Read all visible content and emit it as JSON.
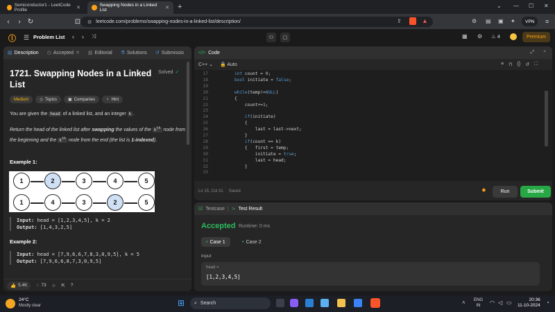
{
  "browser": {
    "tabs": [
      {
        "title": "Semiconductor1 - LeetCode Profile"
      },
      {
        "title": "Swapping Nodes in a Linked List"
      }
    ],
    "url": "leetcode.com/problems/swapping-nodes-in-a-linked-list/description/",
    "vpn_label": "VPN"
  },
  "header": {
    "problem_list_label": "Problem List",
    "streak_count": "4",
    "premium_label": "Premium"
  },
  "left_tabs": [
    {
      "label": "Description"
    },
    {
      "label": "Accepted"
    },
    {
      "label": "Editorial"
    },
    {
      "label": "Solutions"
    },
    {
      "label": "Submissio"
    }
  ],
  "problem": {
    "title": "1721. Swapping Nodes in a Linked List",
    "solved_label": "Solved",
    "difficulty": "Medium",
    "tags": [
      "Topics",
      "Companies",
      "Hint"
    ],
    "desc1_pre": "You are given the",
    "desc1_code": "head",
    "desc1_mid": "of a linked list, and an integer",
    "desc1_code2": "k",
    "desc1_post": ".",
    "desc2_a": "Return the head of the linked list after",
    "desc2_b": "swapping",
    "desc2_c": "the values of the",
    "desc2_d": "k",
    "desc2_e": "th",
    "desc2_f": "node",
    "desc2_g": "from the beginning and the",
    "desc2_h": "node from the end (the list is",
    "desc2_i": "1-indexed",
    "desc2_j": ").",
    "example1_title": "Example 1:",
    "list_top": [
      "1",
      "2",
      "3",
      "4",
      "5"
    ],
    "list_bottom": [
      "1",
      "4",
      "3",
      "2",
      "5"
    ],
    "ex1_input_label": "Input:",
    "ex1_input": "head = [1,2,3,4,5], k = 2",
    "ex1_output_label": "Output:",
    "ex1_output": "[1,4,3,2,5]",
    "example2_title": "Example 2:",
    "ex2_input_label": "Input:",
    "ex2_input": "head = [7,9,6,6,7,8,3,0,9,5], k = 5",
    "ex2_output_label": "Output:",
    "ex2_output": "[7,9,6,6,8,7,3,0,9,5]",
    "likes": "5.4K",
    "comments": "73"
  },
  "code_panel": {
    "title": "Code",
    "language": "C++",
    "mode": "Auto",
    "status": "Ln 15, Col 31",
    "saved": "Saved",
    "run_label": "Run",
    "submit_label": "Submit"
  },
  "code_lines": [
    {
      "n": "17",
      "text": "int count = 0;"
    },
    {
      "n": "18",
      "text": "bool initiate = false;"
    },
    {
      "n": "19",
      "text": ""
    },
    {
      "n": "20",
      "text": "while(temp!=NULL)"
    },
    {
      "n": "21",
      "text": "{"
    },
    {
      "n": "22",
      "text": "    count+=1;"
    },
    {
      "n": "23",
      "text": ""
    },
    {
      "n": "24",
      "text": "    if(initiate)"
    },
    {
      "n": "25",
      "text": "    {"
    },
    {
      "n": "26",
      "text": "        last = last->next;"
    },
    {
      "n": "27",
      "text": "    }"
    },
    {
      "n": "28",
      "text": "    if(count == k)"
    },
    {
      "n": "29",
      "text": "    {   first = temp;"
    },
    {
      "n": "30",
      "text": "        initiate = true;"
    },
    {
      "n": "31",
      "text": "        last = head;"
    },
    {
      "n": "32",
      "text": "    }"
    },
    {
      "n": "33",
      "text": ""
    }
  ],
  "result_panel": {
    "testcase_label": "Testcase",
    "result_label": "Test Result",
    "accepted_label": "Accepted",
    "runtime": "Runtime: 0 ms",
    "case1": "Case 1",
    "case2": "Case 2",
    "input_label": "Input",
    "var_label": "head =",
    "var_value": "[1,2,3,4,5]"
  },
  "taskbar": {
    "temp": "24°C",
    "weather": "Mostly clear",
    "search": "Search",
    "lang": "ENG",
    "region": "IN",
    "time": "20:36",
    "date": "11-10-2024"
  },
  "colors": {
    "accent_orange": "#ffa116",
    "accepted_green": "#2cbb5d",
    "submit_green": "#28a745"
  }
}
